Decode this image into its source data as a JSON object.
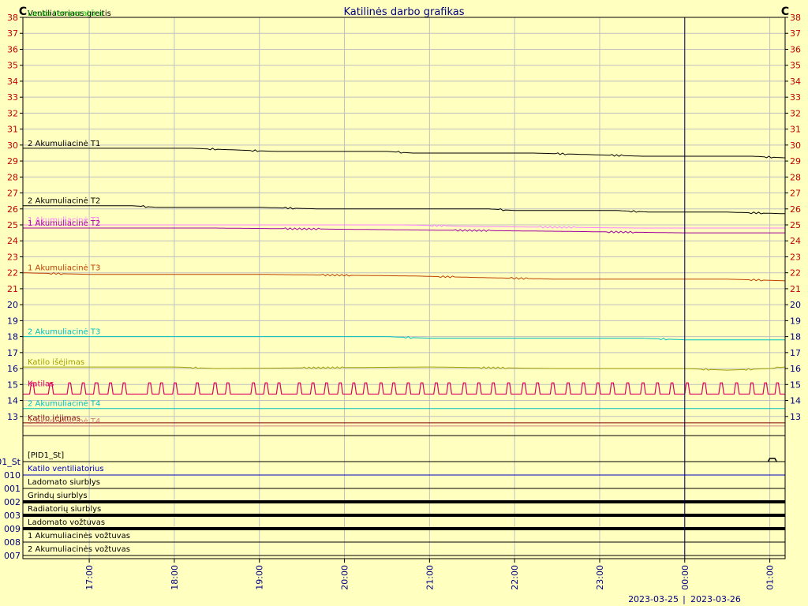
{
  "title": "Katilinės darbo grafikas",
  "unit_left": "C",
  "unit_right": "C",
  "colors": {
    "background": "#ffffc0",
    "grid": "#c0c0c0",
    "tick_red": "#c00000",
    "tick_blue": "#000080",
    "time_label": "#000080"
  },
  "dates": {
    "left": "2023-03-25",
    "right": "2023-03-26"
  },
  "chart_data": {
    "type": "line",
    "title": "Katilinės darbo grafikas",
    "ylabel": "C",
    "ylim": [
      12,
      38
    ],
    "x_tick_labels": [
      "17:00",
      "18:00",
      "19:00",
      "20:00",
      "21:00",
      "22:00",
      "23:00",
      "00:00",
      "01:00"
    ],
    "x_hours": [
      17,
      18,
      19,
      20,
      21,
      22,
      23,
      24,
      25
    ],
    "xlim": [
      16.22,
      25.18
    ],
    "midnight_marker": 24,
    "y_ticks": [
      38,
      37,
      36,
      35,
      34,
      33,
      32,
      31,
      30,
      29,
      28,
      27,
      26,
      25,
      24,
      23,
      22,
      21,
      20,
      19,
      18,
      17,
      16,
      15,
      14,
      13
    ],
    "legend_top": [
      {
        "name": "Ventiliatoriaus greitis",
        "color": "#000000"
      },
      {
        "name": "Lauko temperatūra",
        "color": "#00c000"
      }
    ],
    "series": [
      {
        "name": "2 Akumuliacinė T1",
        "color": "#000000",
        "points": [
          [
            16.22,
            29.8
          ],
          [
            17.0,
            29.8
          ],
          [
            18.2,
            29.8
          ],
          [
            18.7,
            29.7
          ],
          [
            19.2,
            29.6
          ],
          [
            20.5,
            29.6
          ],
          [
            20.8,
            29.5
          ],
          [
            22.2,
            29.5
          ],
          [
            22.9,
            29.4
          ],
          [
            23.5,
            29.3
          ],
          [
            24.0,
            29.3
          ],
          [
            24.8,
            29.3
          ],
          [
            25.18,
            29.2
          ]
        ]
      },
      {
        "name": "2 Akumuliacinė T2",
        "color": "#000000",
        "points": [
          [
            16.22,
            26.2
          ],
          [
            17.5,
            26.2
          ],
          [
            17.8,
            26.1
          ],
          [
            19.0,
            26.1
          ],
          [
            19.7,
            26.0
          ],
          [
            21.7,
            26.0
          ],
          [
            22.0,
            25.9
          ],
          [
            23.2,
            25.9
          ],
          [
            23.6,
            25.8
          ],
          [
            24.5,
            25.8
          ],
          [
            25.18,
            25.7
          ]
        ]
      },
      {
        "name": "1 Akumuliacinė T1",
        "color": "#ff80ff",
        "points": [
          [
            16.22,
            25.0
          ],
          [
            20.7,
            25.0
          ],
          [
            21.5,
            24.9
          ],
          [
            23.5,
            24.8
          ],
          [
            24.5,
            24.8
          ],
          [
            25.18,
            24.8
          ]
        ]
      },
      {
        "name": "1 Akumuliacinė T2",
        "color": "#a000a0",
        "points": [
          [
            16.22,
            24.8
          ],
          [
            18.5,
            24.8
          ],
          [
            20.5,
            24.7
          ],
          [
            22.5,
            24.6
          ],
          [
            24.0,
            24.5
          ],
          [
            25.18,
            24.5
          ]
        ]
      },
      {
        "name": "1 Akumuliacinė T3",
        "color": "#c04000",
        "points": [
          [
            16.22,
            22.0
          ],
          [
            17.0,
            21.9
          ],
          [
            19.0,
            21.9
          ],
          [
            20.8,
            21.8
          ],
          [
            21.6,
            21.7
          ],
          [
            22.5,
            21.6
          ],
          [
            24.5,
            21.6
          ],
          [
            25.18,
            21.5
          ]
        ]
      },
      {
        "name": "2 Akumuliacinė T3",
        "color": "#00c0c0",
        "points": [
          [
            16.22,
            18.0
          ],
          [
            20.5,
            18.0
          ],
          [
            21.0,
            17.9
          ],
          [
            23.5,
            17.9
          ],
          [
            24.0,
            17.8
          ],
          [
            25.18,
            17.8
          ]
        ]
      },
      {
        "name": "Katilo išėjimas",
        "color": "#a0a000",
        "points": [
          [
            16.22,
            16.1
          ],
          [
            18.0,
            16.1
          ],
          [
            18.5,
            16.0
          ],
          [
            21.0,
            16.1
          ],
          [
            22.5,
            16.0
          ],
          [
            24.0,
            16.0
          ],
          [
            24.5,
            15.9
          ],
          [
            25.0,
            16.0
          ],
          [
            25.18,
            16.1
          ]
        ]
      },
      {
        "name": "2 Akumuliacinė T4",
        "color": "#00c0c0",
        "points": [
          [
            16.22,
            13.5
          ],
          [
            25.18,
            13.5
          ]
        ]
      },
      {
        "name": "Katilo įėjimas",
        "color": "#800000",
        "points": [
          [
            16.22,
            12.6
          ],
          [
            25.18,
            12.6
          ]
        ]
      },
      {
        "name": "1 Akumuliacinė T4",
        "color": "#d08080",
        "points": [
          [
            16.22,
            12.4
          ],
          [
            25.18,
            12.4
          ]
        ]
      }
    ],
    "pulse_series": {
      "name": "Katilas",
      "color": "#e00060",
      "low": 14.4,
      "high": 15.1,
      "pulses": [
        [
          16.3,
          16.36
        ],
        [
          16.52,
          16.58
        ],
        [
          16.74,
          16.8
        ],
        [
          16.9,
          16.96
        ],
        [
          17.05,
          17.12
        ],
        [
          17.22,
          17.28
        ],
        [
          17.38,
          17.44
        ],
        [
          17.68,
          17.74
        ],
        [
          17.82,
          17.88
        ],
        [
          17.98,
          18.04
        ],
        [
          18.24,
          18.3
        ],
        [
          18.45,
          18.51
        ],
        [
          18.6,
          18.66
        ],
        [
          18.9,
          18.96
        ],
        [
          19.05,
          19.11
        ],
        [
          19.2,
          19.26
        ],
        [
          19.44,
          19.5
        ],
        [
          19.6,
          19.66
        ],
        [
          19.76,
          19.82
        ],
        [
          19.92,
          19.98
        ],
        [
          20.08,
          20.14
        ],
        [
          20.22,
          20.28
        ],
        [
          20.4,
          20.46
        ],
        [
          20.55,
          20.61
        ],
        [
          20.72,
          20.78
        ],
        [
          20.88,
          20.94
        ],
        [
          21.05,
          21.11
        ],
        [
          21.2,
          21.26
        ],
        [
          21.38,
          21.44
        ],
        [
          21.55,
          21.61
        ],
        [
          21.72,
          21.78
        ],
        [
          21.9,
          21.96
        ],
        [
          22.08,
          22.14
        ],
        [
          22.24,
          22.3
        ],
        [
          22.42,
          22.48
        ],
        [
          22.6,
          22.66
        ],
        [
          22.78,
          22.84
        ],
        [
          22.95,
          23.01
        ],
        [
          23.12,
          23.18
        ],
        [
          23.3,
          23.36
        ],
        [
          23.48,
          23.54
        ],
        [
          23.65,
          23.71
        ],
        [
          23.82,
          23.88
        ],
        [
          24.0,
          24.06
        ],
        [
          24.2,
          24.26
        ],
        [
          24.4,
          24.46
        ],
        [
          24.58,
          24.64
        ],
        [
          24.76,
          24.82
        ],
        [
          24.92,
          24.98
        ],
        [
          25.06,
          25.12
        ]
      ]
    },
    "digital_channels": [
      {
        "code": "01_St",
        "name": "[PID1_St]",
        "color": "#000000",
        "text_color": "#000000",
        "thick": false
      },
      {
        "code": "010",
        "name": "Katilo ventiliatorius",
        "color": "#0000c0",
        "text_color": "#0000c0",
        "thick": false
      },
      {
        "code": "001",
        "name": "Ladomato siurblys",
        "color": "#000000",
        "text_color": "#000000",
        "thick": false
      },
      {
        "code": "002",
        "name": "Grindų siurblys",
        "color": "#000000",
        "text_color": "#000000",
        "thick": true
      },
      {
        "code": "003",
        "name": "Radiatorių siurblys",
        "color": "#000000",
        "text_color": "#000000",
        "thick": true
      },
      {
        "code": "009",
        "name": "Ladomato vožtuvas",
        "color": "#000000",
        "text_color": "#000000",
        "thick": true
      },
      {
        "code": "008",
        "name": "1 Akumuliacinės vožtuvas",
        "color": "#000000",
        "text_color": "#000000",
        "thick": false
      },
      {
        "code": "007",
        "name": "2 Akumuliacinės vožtuvas",
        "color": "#000000",
        "text_color": "#000000",
        "thick": false
      }
    ]
  }
}
